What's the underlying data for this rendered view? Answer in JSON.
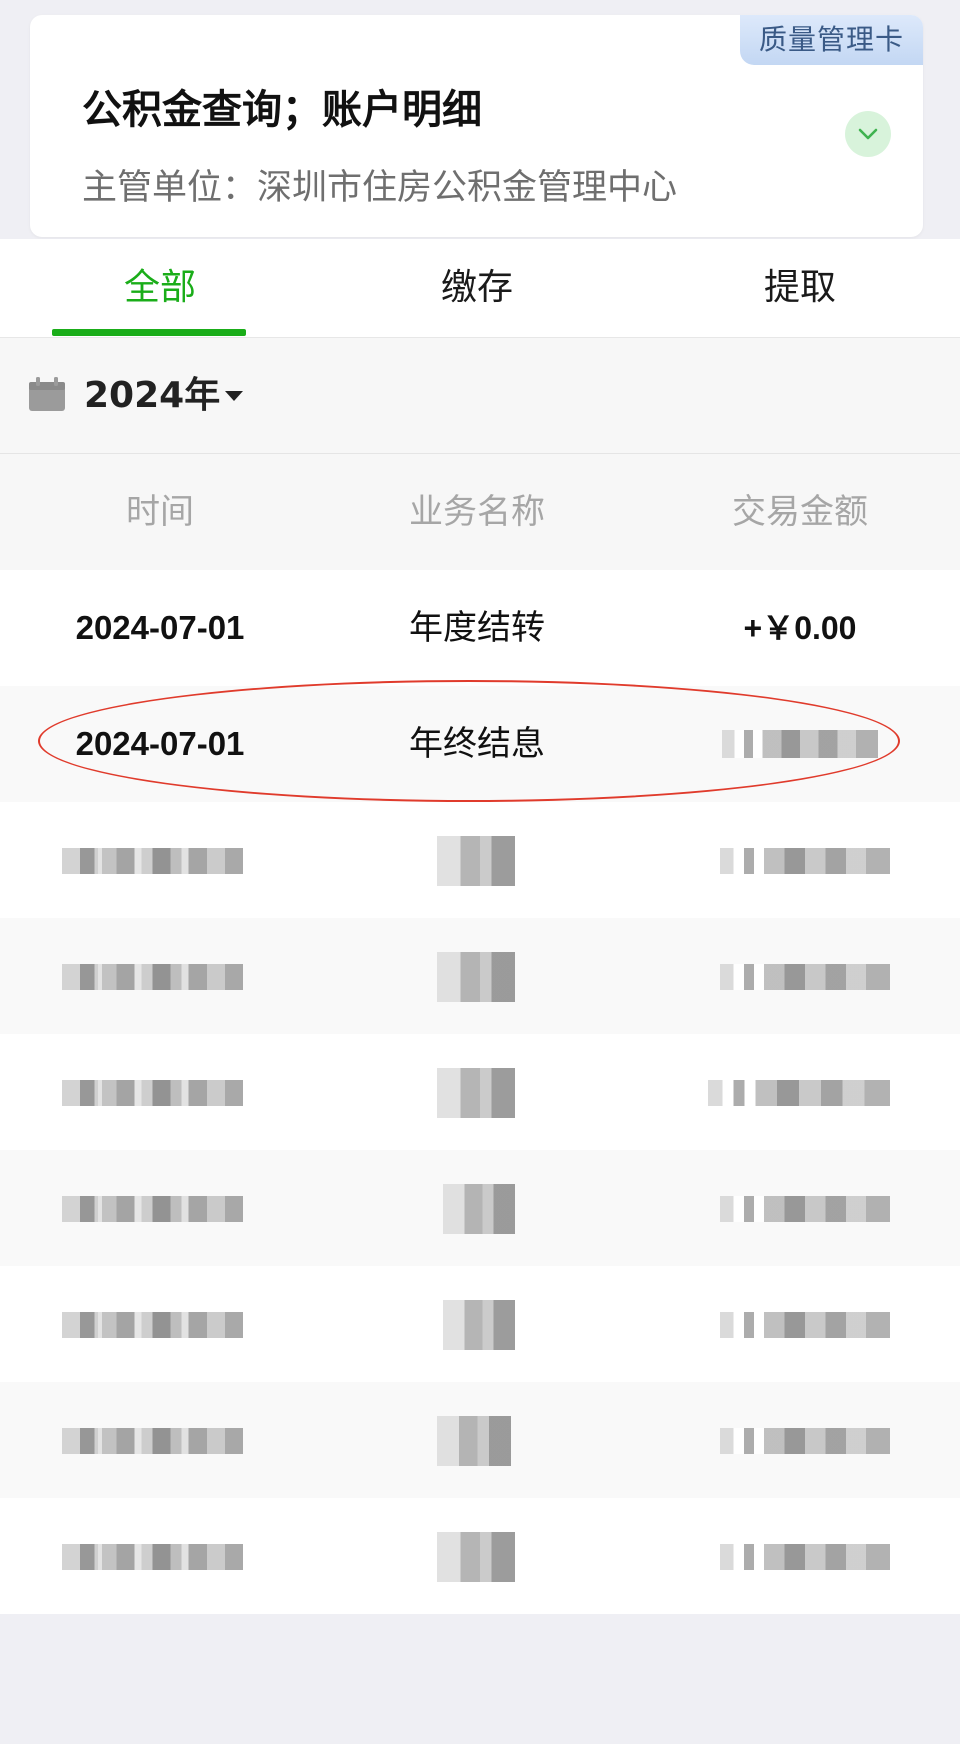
{
  "card": {
    "badge": "质量管理卡",
    "title": "公积金查询；账户明细",
    "subtitle": "主管单位：深圳市住房公积金管理中心"
  },
  "tabs": [
    {
      "label": "全部",
      "active": true
    },
    {
      "label": "缴存",
      "active": false
    },
    {
      "label": "提取",
      "active": false
    }
  ],
  "year_filter": {
    "label": "2024年"
  },
  "table": {
    "headers": [
      "时间",
      "业务名称",
      "交易金额"
    ],
    "rows": [
      {
        "date": "2024-07-01",
        "name": "年度结转",
        "amount": "+￥0.00",
        "redacted": false
      },
      {
        "date": "2024-07-01",
        "name": "年终结息",
        "amount": "",
        "redacted_amount": true
      },
      {
        "redacted": true
      },
      {
        "redacted": true
      },
      {
        "redacted": true
      },
      {
        "redacted": true
      },
      {
        "redacted": true
      },
      {
        "redacted": true
      },
      {
        "redacted": true
      }
    ]
  },
  "colors": {
    "accent": "#1aad19",
    "badge_text": "#3a5a86",
    "annotation": "#e03b2c"
  }
}
